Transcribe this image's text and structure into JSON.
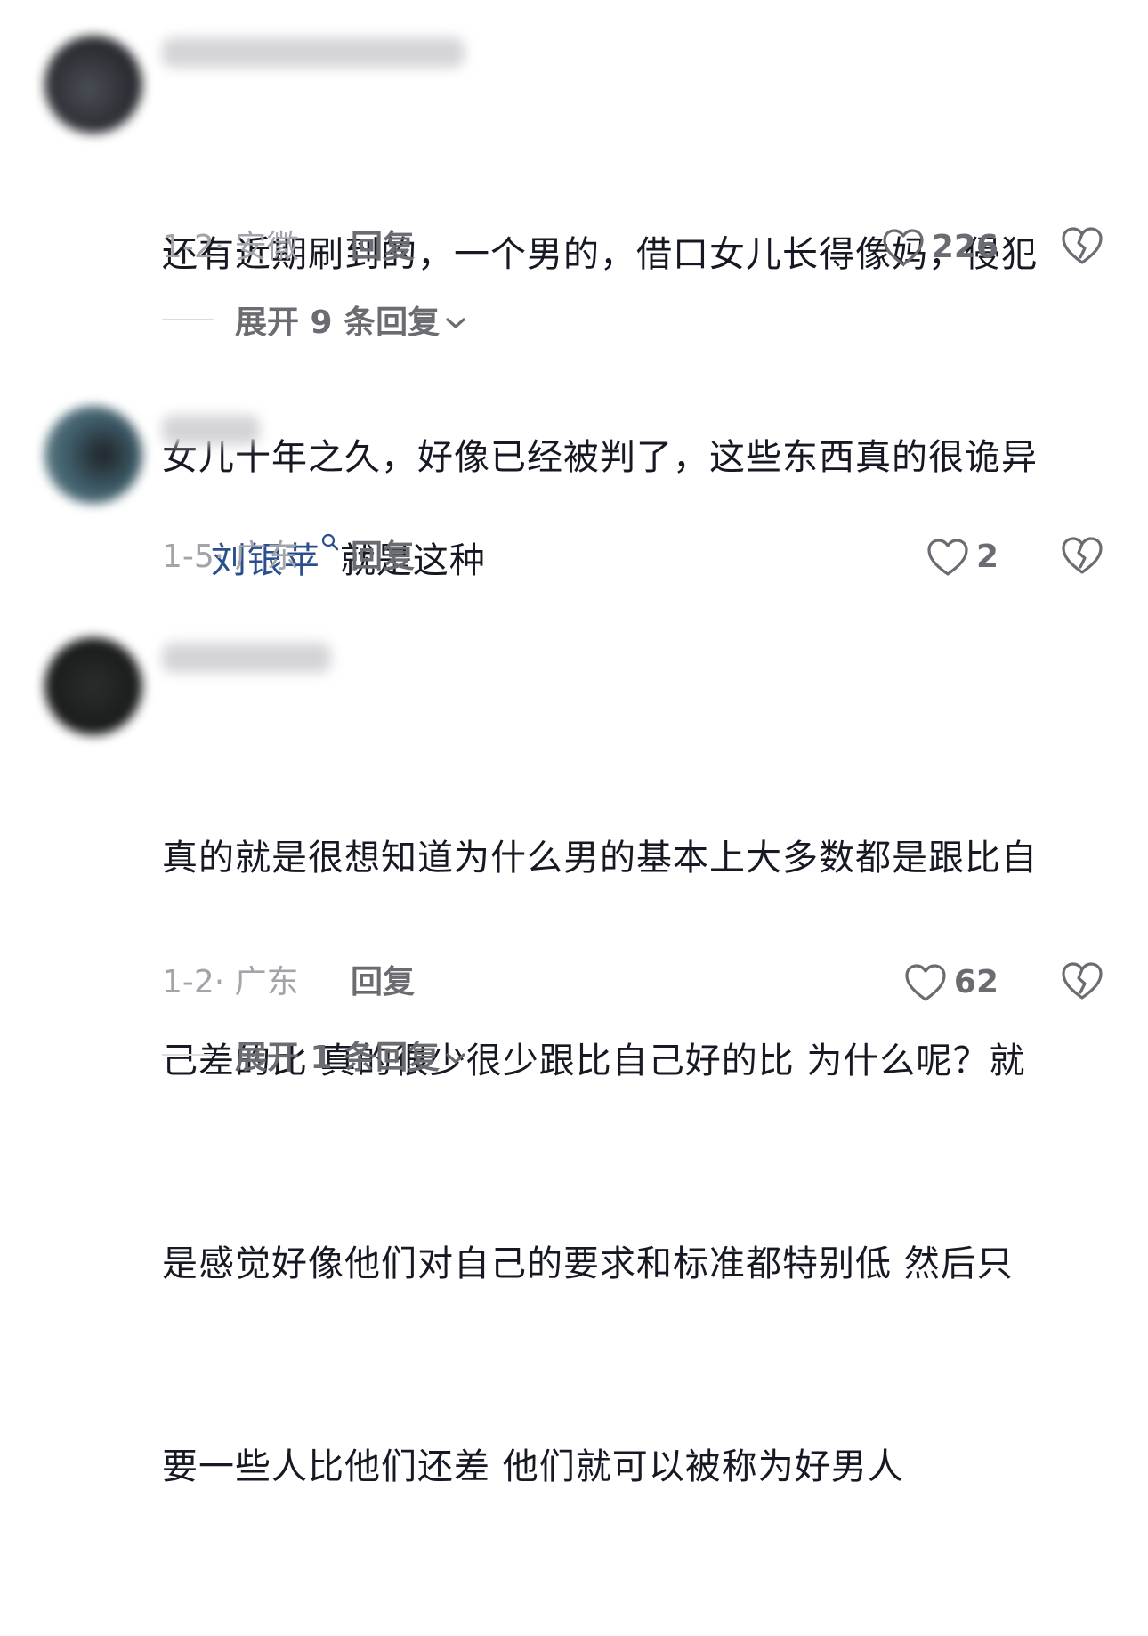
{
  "comments": [
    {
      "content_lines": [
        "还有近期刷到的，一个男的，借口女儿长得像妈，侵犯",
        "女儿十年之久，好像已经被判了，这些东西真的很诡异"
      ],
      "date_location": "1-2· 安徽",
      "reply_label": "回复",
      "likes": "226",
      "expand_label": "展开 9 条回复"
    },
    {
      "mention": "刘银苹",
      "content": "就是这种",
      "date_location": "1-5· 广东",
      "reply_label": "回复",
      "likes": "2"
    },
    {
      "content_lines": [
        "真的就是很想知道为什么男的基本上大多数都是跟比自",
        "己差的比 真的很少很少跟比自己好的比 为什么呢？就",
        "是感觉好像他们对自己的要求和标准都特别低 然后只",
        "要一些人比他们还差 他们就可以被称为好男人"
      ],
      "date_location": "1-2· 广东",
      "reply_label": "回复",
      "likes": "62",
      "expand_label": "展开 1 条回复"
    }
  ],
  "colors": {
    "text_primary": "#161823",
    "text_meta": "#a3a4aa",
    "text_secondary": "#6b6c72",
    "mention": "#2b4f8c"
  }
}
